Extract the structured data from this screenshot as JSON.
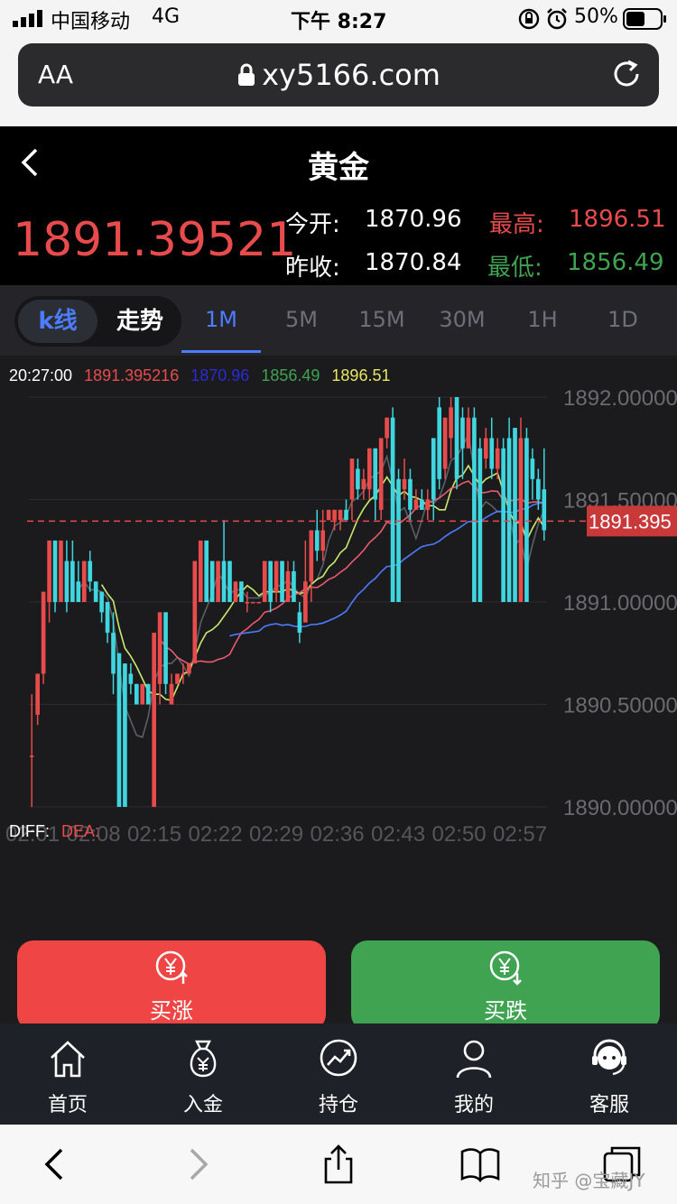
{
  "status_bar": {
    "carrier": "中国移动",
    "network": "4G",
    "time": "下午 8:27",
    "battery": "50%"
  },
  "browser": {
    "aa_label": "AA",
    "url": "xy5166.com"
  },
  "header": {
    "title": "黄金",
    "current_price": "1891.39521"
  },
  "stats": {
    "open_label": "今开:",
    "open_value": "1870.96",
    "high_label": "最高:",
    "high_value": "1896.51",
    "prev_close_label": "昨收:",
    "prev_close_value": "1870.84",
    "low_label": "最低:",
    "low_value": "1856.49"
  },
  "chart_mode": {
    "kline": "k线",
    "trend": "走势"
  },
  "timeframes": [
    "1M",
    "5M",
    "15M",
    "30M",
    "1H",
    "1D"
  ],
  "active_timeframe": "1M",
  "chart_info": {
    "time": "20:27:00",
    "close": "1891.395216",
    "open": "1870.96",
    "low": "1856.49",
    "high": "1896.51"
  },
  "indicator": {
    "diff_label": "DIFF:",
    "dea_label": "DEA:"
  },
  "chart_data": {
    "type": "candlestick",
    "y_tick_labels": [
      "1892.00000",
      "1891.50000",
      "1891.00000",
      "1890.50000",
      "1890.00000"
    ],
    "ylim": [
      1890.0,
      1892.0
    ],
    "x_tick_labels": [
      "02:01",
      "02:08",
      "02:15",
      "02:22",
      "02:29",
      "02:36",
      "02:43",
      "02:50",
      "02:57"
    ],
    "current_price_label": "1891.395",
    "current_price": 1891.395,
    "candles": [
      {
        "o": 1890.25,
        "c": 1890.25,
        "h": 1890.55,
        "l": 1890.0
      },
      {
        "o": 1890.45,
        "c": 1890.65,
        "h": 1890.65,
        "l": 1890.4
      },
      {
        "o": 1890.65,
        "c": 1891.05,
        "h": 1891.05,
        "l": 1890.6
      },
      {
        "o": 1891.0,
        "c": 1891.3,
        "h": 1891.3,
        "l": 1890.9
      },
      {
        "o": 1891.3,
        "c": 1891.0,
        "h": 1891.3,
        "l": 1890.95
      },
      {
        "o": 1891.0,
        "c": 1891.3,
        "h": 1891.3,
        "l": 1891.0
      },
      {
        "o": 1891.2,
        "c": 1891.0,
        "h": 1891.3,
        "l": 1890.95
      },
      {
        "o": 1891.2,
        "c": 1891.0,
        "h": 1891.3,
        "l": 1891.0
      },
      {
        "o": 1891.1,
        "c": 1891.0,
        "h": 1891.2,
        "l": 1891.0
      },
      {
        "o": 1891.0,
        "c": 1891.2,
        "h": 1891.2,
        "l": 1891.0
      },
      {
        "o": 1891.2,
        "c": 1891.1,
        "h": 1891.25,
        "l": 1891.05
      },
      {
        "o": 1891.1,
        "c": 1891.0,
        "h": 1891.1,
        "l": 1891.0
      },
      {
        "o": 1891.05,
        "c": 1890.95,
        "h": 1891.05,
        "l": 1890.9
      },
      {
        "o": 1891.0,
        "c": 1890.85,
        "h": 1891.0,
        "l": 1890.8
      },
      {
        "o": 1890.85,
        "c": 1890.65,
        "h": 1890.95,
        "l": 1890.55
      },
      {
        "o": 1890.75,
        "c": 1890.0,
        "h": 1890.75,
        "l": 1890.0
      },
      {
        "o": 1890.7,
        "c": 1890.0,
        "h": 1890.7,
        "l": 1890.0
      },
      {
        "o": 1890.65,
        "c": 1890.6,
        "h": 1890.7,
        "l": 1890.55
      },
      {
        "o": 1890.6,
        "c": 1890.5,
        "h": 1890.6,
        "l": 1890.5
      },
      {
        "o": 1890.5,
        "c": 1890.6,
        "h": 1890.6,
        "l": 1890.5
      },
      {
        "o": 1890.6,
        "c": 1890.5,
        "h": 1890.6,
        "l": 1890.5
      },
      {
        "o": 1890.0,
        "c": 1890.85,
        "h": 1890.85,
        "l": 1890.0
      },
      {
        "o": 1890.6,
        "c": 1890.95,
        "h": 1890.95,
        "l": 1890.5
      },
      {
        "o": 1890.95,
        "c": 1890.6,
        "h": 1890.95,
        "l": 1890.55
      },
      {
        "o": 1890.5,
        "c": 1890.6,
        "h": 1890.65,
        "l": 1890.5
      },
      {
        "o": 1890.6,
        "c": 1890.65,
        "h": 1890.65,
        "l": 1890.6
      },
      {
        "o": 1890.65,
        "c": 1890.65,
        "h": 1890.7,
        "l": 1890.6
      },
      {
        "o": 1890.65,
        "c": 1890.7,
        "h": 1890.7,
        "l": 1890.65
      },
      {
        "o": 1890.7,
        "c": 1891.2,
        "h": 1891.2,
        "l": 1890.7
      },
      {
        "o": 1891.0,
        "c": 1891.3,
        "h": 1891.3,
        "l": 1891.0
      },
      {
        "o": 1891.3,
        "c": 1891.0,
        "h": 1891.3,
        "l": 1891.0
      },
      {
        "o": 1891.2,
        "c": 1891.0,
        "h": 1891.2,
        "l": 1891.0
      },
      {
        "o": 1891.0,
        "c": 1891.2,
        "h": 1891.2,
        "l": 1891.0
      },
      {
        "o": 1891.2,
        "c": 1891.0,
        "h": 1891.4,
        "l": 1891.0
      },
      {
        "o": 1891.2,
        "c": 1891.0,
        "h": 1891.2,
        "l": 1891.0
      },
      {
        "o": 1891.0,
        "c": 1891.1,
        "h": 1891.1,
        "l": 1891.0
      },
      {
        "o": 1891.1,
        "c": 1891.0,
        "h": 1891.1,
        "l": 1891.0
      },
      {
        "o": 1891.0,
        "c": 1891.0,
        "h": 1891.05,
        "l": 1890.95
      },
      {
        "o": 1891.0,
        "c": 1891.0,
        "h": 1891.0,
        "l": 1891.0
      },
      {
        "o": 1891.0,
        "c": 1891.0,
        "h": 1891.0,
        "l": 1891.0
      },
      {
        "o": 1891.0,
        "c": 1891.2,
        "h": 1891.2,
        "l": 1891.0
      },
      {
        "o": 1891.2,
        "c": 1891.0,
        "h": 1891.2,
        "l": 1890.95
      },
      {
        "o": 1891.05,
        "c": 1891.2,
        "h": 1891.2,
        "l": 1891.0
      },
      {
        "o": 1891.2,
        "c": 1891.0,
        "h": 1891.2,
        "l": 1891.0
      },
      {
        "o": 1891.0,
        "c": 1891.15,
        "h": 1891.2,
        "l": 1891.0
      },
      {
        "o": 1891.15,
        "c": 1891.0,
        "h": 1891.2,
        "l": 1891.0
      },
      {
        "o": 1890.95,
        "c": 1890.85,
        "h": 1891.0,
        "l": 1890.8
      },
      {
        "o": 1890.9,
        "c": 1891.1,
        "h": 1891.3,
        "l": 1890.9
      },
      {
        "o": 1891.1,
        "c": 1891.35,
        "h": 1891.35,
        "l": 1891.0
      },
      {
        "o": 1891.35,
        "c": 1891.25,
        "h": 1891.45,
        "l": 1891.2
      },
      {
        "o": 1891.25,
        "c": 1891.35,
        "h": 1891.45,
        "l": 1891.2
      },
      {
        "o": 1891.4,
        "c": 1891.45,
        "h": 1891.45,
        "l": 1891.4
      },
      {
        "o": 1891.4,
        "c": 1891.45,
        "h": 1891.45,
        "l": 1891.35
      },
      {
        "o": 1891.4,
        "c": 1891.45,
        "h": 1891.45,
        "l": 1891.35
      },
      {
        "o": 1891.45,
        "c": 1891.4,
        "h": 1891.5,
        "l": 1891.4
      },
      {
        "o": 1891.5,
        "c": 1891.7,
        "h": 1891.7,
        "l": 1891.4
      },
      {
        "o": 1891.65,
        "c": 1891.55,
        "h": 1891.7,
        "l": 1891.5
      },
      {
        "o": 1891.55,
        "c": 1891.6,
        "h": 1891.65,
        "l": 1891.5
      },
      {
        "o": 1891.55,
        "c": 1891.75,
        "h": 1891.75,
        "l": 1891.5
      },
      {
        "o": 1891.75,
        "c": 1891.5,
        "h": 1891.75,
        "l": 1891.4
      },
      {
        "o": 1891.45,
        "c": 1891.8,
        "h": 1891.8,
        "l": 1891.4
      },
      {
        "o": 1891.8,
        "c": 1891.9,
        "h": 1891.9,
        "l": 1891.75
      },
      {
        "o": 1891.9,
        "c": 1891.0,
        "h": 1891.95,
        "l": 1891.0
      },
      {
        "o": 1891.6,
        "c": 1891.0,
        "h": 1891.65,
        "l": 1891.0
      },
      {
        "o": 1891.55,
        "c": 1891.6,
        "h": 1891.7,
        "l": 1891.5
      },
      {
        "o": 1891.6,
        "c": 1891.45,
        "h": 1891.65,
        "l": 1891.4
      },
      {
        "o": 1891.45,
        "c": 1891.5,
        "h": 1891.55,
        "l": 1891.45
      },
      {
        "o": 1891.5,
        "c": 1891.45,
        "h": 1891.55,
        "l": 1891.45
      },
      {
        "o": 1891.45,
        "c": 1891.5,
        "h": 1891.55,
        "l": 1891.4
      },
      {
        "o": 1891.8,
        "c": 1891.5,
        "h": 1891.8,
        "l": 1891.4
      },
      {
        "o": 1891.95,
        "c": 1891.6,
        "h": 1892.0,
        "l": 1891.55
      },
      {
        "o": 1891.65,
        "c": 1891.9,
        "h": 1891.9,
        "l": 1891.6
      },
      {
        "o": 1891.8,
        "c": 1891.95,
        "h": 1892.0,
        "l": 1891.7
      },
      {
        "o": 1892.0,
        "c": 1891.6,
        "h": 1892.0,
        "l": 1891.55
      },
      {
        "o": 1891.9,
        "c": 1891.75,
        "h": 1891.95,
        "l": 1891.6
      },
      {
        "o": 1891.75,
        "c": 1891.9,
        "h": 1891.95,
        "l": 1891.75
      },
      {
        "o": 1891.9,
        "c": 1891.0,
        "h": 1891.95,
        "l": 1891.0
      },
      {
        "o": 1891.75,
        "c": 1891.0,
        "h": 1891.8,
        "l": 1891.0
      },
      {
        "o": 1891.7,
        "c": 1891.8,
        "h": 1891.85,
        "l": 1891.65
      },
      {
        "o": 1891.8,
        "c": 1891.65,
        "h": 1891.9,
        "l": 1891.6
      },
      {
        "o": 1891.65,
        "c": 1891.75,
        "h": 1891.8,
        "l": 1891.6
      },
      {
        "o": 1891.75,
        "c": 1891.0,
        "h": 1891.8,
        "l": 1891.0
      },
      {
        "o": 1891.8,
        "c": 1891.0,
        "h": 1891.9,
        "l": 1891.0
      },
      {
        "o": 1891.85,
        "c": 1891.0,
        "h": 1891.85,
        "l": 1891.0
      },
      {
        "o": 1891.0,
        "c": 1891.8,
        "h": 1891.9,
        "l": 1891.0
      },
      {
        "o": 1891.8,
        "c": 1891.0,
        "h": 1891.85,
        "l": 1891.0
      },
      {
        "o": 1891.7,
        "c": 1891.6,
        "h": 1891.75,
        "l": 1891.5
      },
      {
        "o": 1891.6,
        "c": 1891.5,
        "h": 1891.65,
        "l": 1891.45
      },
      {
        "o": 1891.55,
        "c": 1891.35,
        "h": 1891.75,
        "l": 1891.3
      }
    ]
  },
  "buttons": {
    "buy_up": "买涨",
    "buy_down": "买跌"
  },
  "tabbar": [
    "首页",
    "入金",
    "持仓",
    "我的",
    "客服"
  ],
  "watermark": "知乎 @宝藏JY",
  "colors": {
    "up": "#e84b4b",
    "down": "#3fd6e0",
    "ma1": "#c8ea6e",
    "ma2": "#e95a6d",
    "ma3": "#4c7cff",
    "buy_up_bg": "#f04545",
    "buy_down_bg": "#3fa352"
  }
}
